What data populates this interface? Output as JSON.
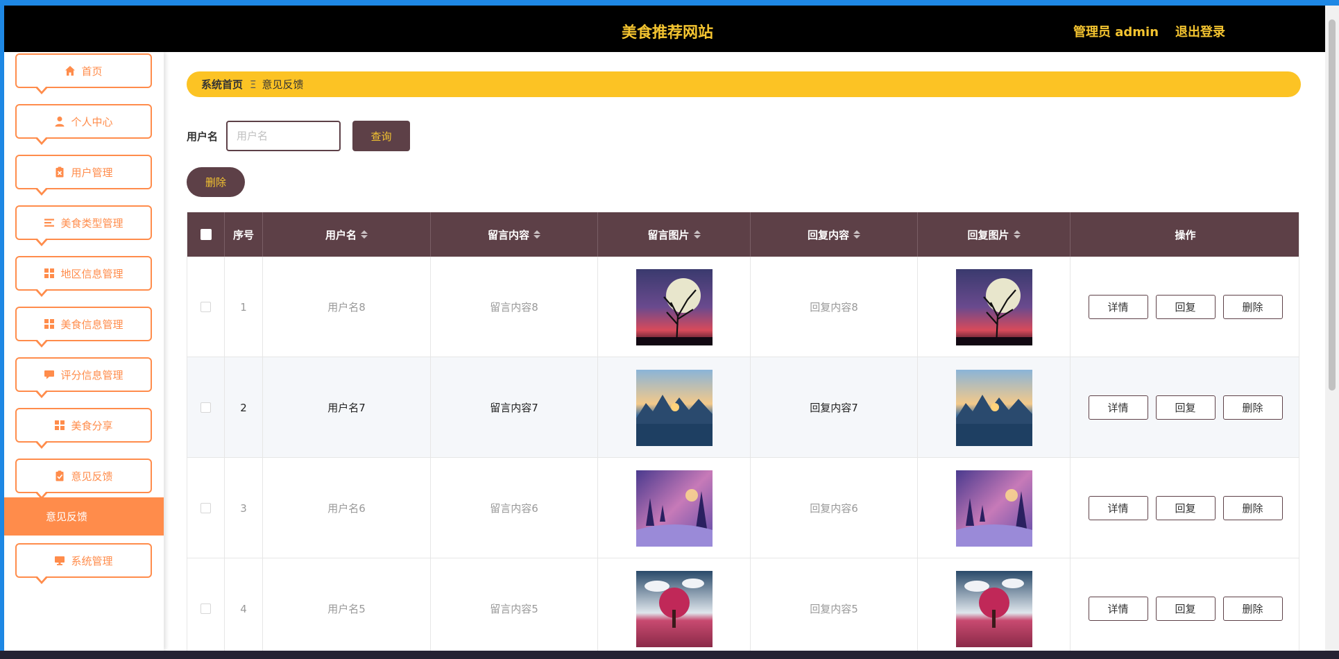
{
  "header": {
    "site_title": "美食推荐网站",
    "admin_label": "管理员 admin",
    "logout_label": "退出登录"
  },
  "sidebar": {
    "items": [
      {
        "label": "首页",
        "icon": "home-icon"
      },
      {
        "label": "个人中心",
        "icon": "person-icon"
      },
      {
        "label": "用户管理",
        "icon": "clipboard-x-icon"
      },
      {
        "label": "美食类型管理",
        "icon": "list-icon"
      },
      {
        "label": "地区信息管理",
        "icon": "grid-icon"
      },
      {
        "label": "美食信息管理",
        "icon": "grid-icon"
      },
      {
        "label": "评分信息管理",
        "icon": "message-icon"
      },
      {
        "label": "美食分享",
        "icon": "grid-icon"
      },
      {
        "label": "意见反馈",
        "icon": "clipboard-check-icon"
      },
      {
        "label": "系统管理",
        "icon": "monitor-icon"
      }
    ],
    "active_submenu": "意见反馈"
  },
  "breadcrumb": {
    "home": "系统首页",
    "separator": "Ξ",
    "current": "意见反馈"
  },
  "search": {
    "label": "用户名",
    "placeholder": "用户名",
    "value": "",
    "query_label": "查询"
  },
  "actions": {
    "delete_label": "删除"
  },
  "table": {
    "columns": [
      "序号",
      "用户名",
      "留言内容",
      "留言图片",
      "回复内容",
      "回复图片",
      "操作"
    ],
    "rows": [
      {
        "index": "1",
        "username": "用户名8",
        "message": "留言内容8",
        "message_image": "moon-tree-image",
        "reply": "回复内容8",
        "reply_image": "moon-tree-image"
      },
      {
        "index": "2",
        "username": "用户名7",
        "message": "留言内容7",
        "message_image": "mountain-lake-image",
        "reply": "回复内容7",
        "reply_image": "mountain-lake-image"
      },
      {
        "index": "3",
        "username": "用户名6",
        "message": "留言内容6",
        "message_image": "winter-forest-image",
        "reply": "回复内容6",
        "reply_image": "winter-forest-image"
      },
      {
        "index": "4",
        "username": "用户名5",
        "message": "留言内容5",
        "message_image": "pink-tree-image",
        "reply": "回复内容5",
        "reply_image": "pink-tree-image"
      }
    ],
    "row_actions": {
      "detail": "详情",
      "reply": "回复",
      "delete": "删除"
    }
  },
  "colors": {
    "header_bg": "#000000",
    "accent_yellow": "#f4c430",
    "breadcrumb_bg": "#fcc324",
    "sidebar_orange": "#ff8c4b",
    "table_header_bg": "#5d4047"
  }
}
